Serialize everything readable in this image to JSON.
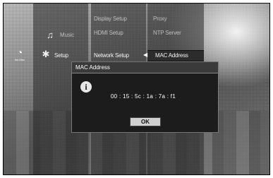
{
  "menu": {
    "main": [
      {
        "label": "Music",
        "icon": "music-note-icon"
      },
      {
        "label": "Setup",
        "icon": "setup-icon"
      }
    ],
    "submenu": [
      {
        "label": "Display Setup"
      },
      {
        "label": "HDMI Setup"
      },
      {
        "label": "Network Setup"
      }
    ],
    "options": [
      {
        "label": "Proxy"
      },
      {
        "label": "NTP Server"
      },
      {
        "label": "MAC Address"
      }
    ],
    "disc_badge": {
      "label": "No Disc",
      "icon": "disc-icon"
    }
  },
  "dialog": {
    "title": "MAC Address",
    "icon": "info-icon",
    "value": "00 : 15 : 5c : 1a : 7a : f1",
    "ok_label": "OK"
  },
  "colors": {
    "dialog_bg": "#1c1c1c",
    "selection_bg": "#2c2c2c"
  }
}
